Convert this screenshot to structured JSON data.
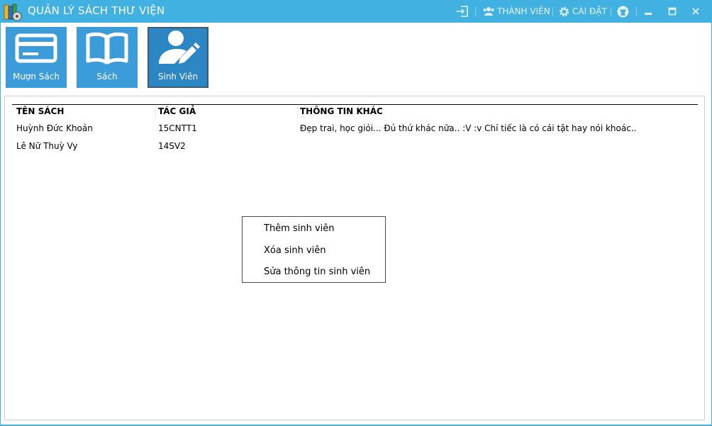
{
  "window": {
    "title": "QUẢN LÝ SÁCH THƯ VIỆN",
    "accent_color": "#41b1e1",
    "app_icon": "books-icon",
    "controls": {
      "login_icon": "sign-in-icon",
      "members_icon": "users-icon",
      "members_label": "THÀNH VIÊN",
      "settings_icon": "gear-icon",
      "settings_label": "CÀI ĐẶT",
      "github_icon": "github-icon",
      "minimize_icon": "minimize-icon",
      "maximize_icon": "maximize-icon",
      "close_icon": "close-icon"
    }
  },
  "tiles": [
    {
      "label": "Mượn Sách",
      "icon": "card-icon",
      "active": false
    },
    {
      "label": "Sách",
      "icon": "open-book-icon",
      "active": false
    },
    {
      "label": "Sinh Viên",
      "icon": "user-edit-icon",
      "active": true
    }
  ],
  "table": {
    "columns": [
      "TÊN SÁCH",
      "TÁC GIẢ",
      "THÔNG TIN KHÁC"
    ],
    "rows": [
      [
        "Huỳnh Đức Khoản",
        "15CNTT1",
        "Đẹp trai, học giỏi... Đủ thứ khác nữa.. :V :v  Chỉ tiếc là có cái tật hay nói khoác.."
      ],
      [
        "Lê Nữ Thuỳ Vy",
        "14SV2",
        ""
      ]
    ]
  },
  "context_menu": {
    "items": [
      "Thêm sinh viên",
      "Xóa sinh viên",
      "Sửa thông tin sinh viên"
    ]
  }
}
